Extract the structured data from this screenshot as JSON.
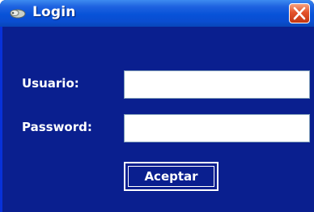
{
  "window": {
    "title": "Login",
    "icon": "keys-icon",
    "close_icon": "close-icon"
  },
  "form": {
    "user_label": "Usuario:",
    "user_value": "",
    "password_label": "Password:",
    "password_value": "",
    "submit_label": "Aceptar"
  },
  "colors": {
    "title_bar": "#0752d8",
    "background": "#0a1f8f",
    "close_button": "#e3532b",
    "text": "#ffffff"
  }
}
